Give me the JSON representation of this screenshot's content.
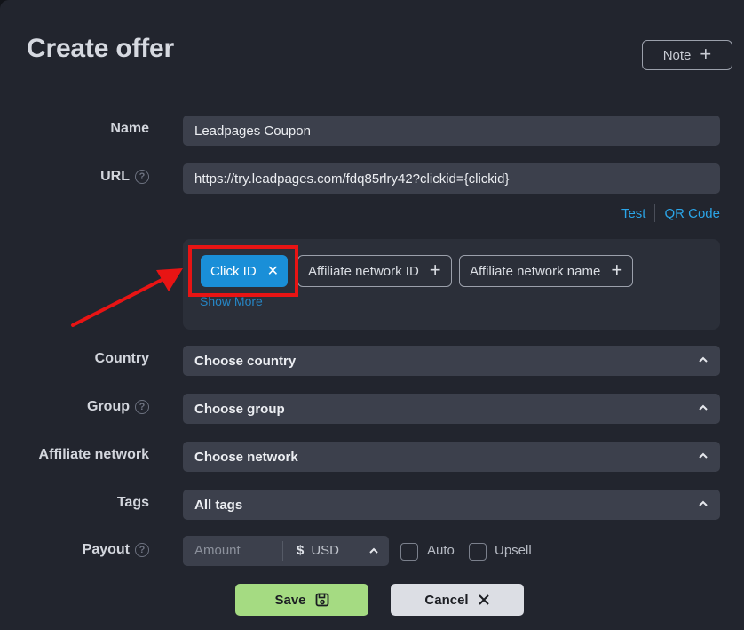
{
  "header": {
    "title": "Create offer",
    "note_label": "Note"
  },
  "form": {
    "name_label": "Name",
    "name_value": "Leadpages Coupon",
    "url_label": "URL",
    "url_value": "https://try.leadpages.com/fdq85rlry42?clickid={clickid}",
    "test_link": "Test",
    "qr_link": "QR Code",
    "params": {
      "active_chip": "Click ID",
      "chips": [
        "Affiliate network ID",
        "Affiliate network name"
      ],
      "show_more": "Show More"
    },
    "country_label": "Country",
    "country_value": "Choose country",
    "group_label": "Group",
    "group_value": "Choose group",
    "network_label": "Affiliate network",
    "network_value": "Choose network",
    "tags_label": "Tags",
    "tags_value": "All tags",
    "payout_label": "Payout",
    "payout_placeholder": "Amount",
    "currency_symbol": "$",
    "currency_value": "USD",
    "auto_label": "Auto",
    "upsell_label": "Upsell"
  },
  "actions": {
    "save_label": "Save",
    "cancel_label": "Cancel"
  },
  "colors": {
    "accent": "#1a8fd8",
    "link": "#2ba5e8",
    "save": "#a5db82",
    "highlight": "#e81414"
  },
  "icons": [
    "help-icon",
    "chevron-up-icon",
    "close-icon",
    "plus-icon",
    "floppy-disk-icon",
    "annotation-arrow"
  ]
}
